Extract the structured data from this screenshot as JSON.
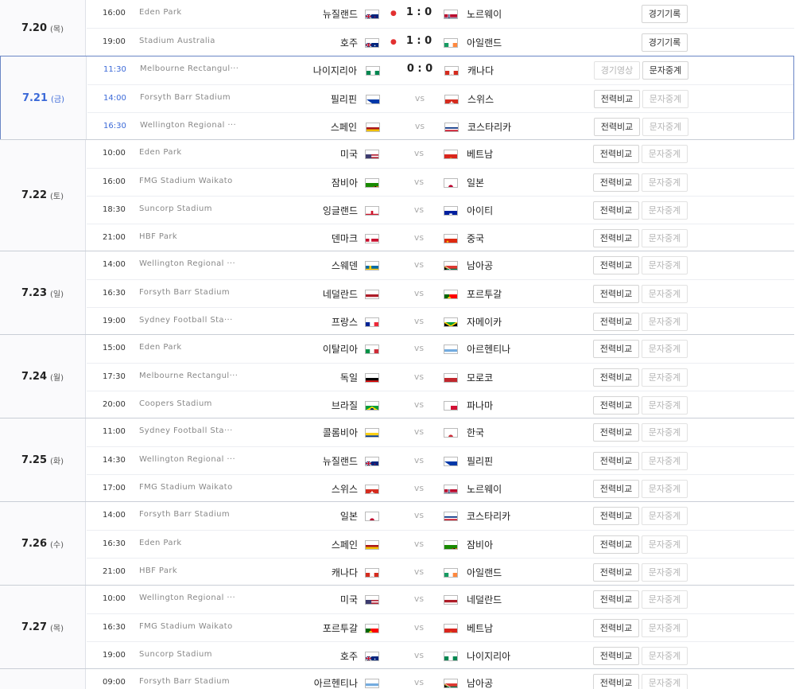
{
  "days": [
    {
      "date": "7.20",
      "dow": "(목)",
      "today": false,
      "top": 0,
      "matches": [
        {
          "time": "16:00",
          "stadium": "Eden Park",
          "home": "뉴질랜드",
          "home_flag": "nz",
          "score": "1 : 0",
          "dot": true,
          "away": "노르웨이",
          "away_flag": "no",
          "buttons": [
            {
              "label": "경기기록",
              "enabled": true
            }
          ]
        },
        {
          "time": "19:00",
          "stadium": "Stadium Australia",
          "home": "호주",
          "home_flag": "au",
          "score": "1 : 0",
          "dot": true,
          "away": "아일랜드",
          "away_flag": "ie",
          "buttons": [
            {
              "label": "경기기록",
              "enabled": true
            }
          ]
        }
      ]
    },
    {
      "date": "7.21",
      "dow": "(금)",
      "today": true,
      "matches": [
        {
          "time": "11:30",
          "stadium": "Melbourne Rectangul···",
          "home": "나이지리아",
          "home_flag": "ng",
          "score": "0 : 0",
          "dot": false,
          "away": "캐나다",
          "away_flag": "ca",
          "buttons": [
            {
              "label": "경기영상",
              "enabled": false
            },
            {
              "label": "문자중계",
              "enabled": true
            }
          ]
        },
        {
          "time": "14:00",
          "stadium": "Forsyth Barr Stadium",
          "home": "필리핀",
          "home_flag": "ph",
          "score": "vs",
          "dot": false,
          "away": "스위스",
          "away_flag": "ch",
          "buttons": [
            {
              "label": "전력비교",
              "enabled": true
            },
            {
              "label": "문자중계",
              "enabled": false
            }
          ]
        },
        {
          "time": "16:30",
          "stadium": "Wellington Regional ···",
          "home": "스페인",
          "home_flag": "es",
          "score": "vs",
          "dot": false,
          "away": "코스타리카",
          "away_flag": "cr",
          "buttons": [
            {
              "label": "전력비교",
              "enabled": true
            },
            {
              "label": "문자중계",
              "enabled": false
            }
          ]
        }
      ]
    },
    {
      "date": "7.22",
      "dow": "(토)",
      "today": false,
      "matches": [
        {
          "time": "10:00",
          "stadium": "Eden Park",
          "home": "미국",
          "home_flag": "us",
          "score": "vs",
          "dot": false,
          "away": "베트남",
          "away_flag": "vn",
          "buttons": [
            {
              "label": "전력비교",
              "enabled": true
            },
            {
              "label": "문자중계",
              "enabled": false
            }
          ]
        },
        {
          "time": "16:00",
          "stadium": "FMG Stadium Waikato",
          "home": "잠비아",
          "home_flag": "zm",
          "score": "vs",
          "dot": false,
          "away": "일본",
          "away_flag": "jp",
          "buttons": [
            {
              "label": "전력비교",
              "enabled": true
            },
            {
              "label": "문자중계",
              "enabled": false
            }
          ]
        },
        {
          "time": "18:30",
          "stadium": "Suncorp Stadium",
          "home": "잉글랜드",
          "home_flag": "en",
          "score": "vs",
          "dot": false,
          "away": "아이티",
          "away_flag": "ht",
          "buttons": [
            {
              "label": "전력비교",
              "enabled": true
            },
            {
              "label": "문자중계",
              "enabled": false
            }
          ]
        },
        {
          "time": "21:00",
          "stadium": "HBF Park",
          "home": "덴마크",
          "home_flag": "dk",
          "score": "vs",
          "dot": false,
          "away": "중국",
          "away_flag": "cn",
          "buttons": [
            {
              "label": "전력비교",
              "enabled": true
            },
            {
              "label": "문자중계",
              "enabled": false
            }
          ]
        }
      ]
    },
    {
      "date": "7.23",
      "dow": "(일)",
      "today": false,
      "matches": [
        {
          "time": "14:00",
          "stadium": "Wellington Regional ···",
          "home": "스웨덴",
          "home_flag": "se",
          "score": "vs",
          "dot": false,
          "away": "남아공",
          "away_flag": "za",
          "buttons": [
            {
              "label": "전력비교",
              "enabled": true
            },
            {
              "label": "문자중계",
              "enabled": false
            }
          ]
        },
        {
          "time": "16:30",
          "stadium": "Forsyth Barr Stadium",
          "home": "네덜란드",
          "home_flag": "nl",
          "score": "vs",
          "dot": false,
          "away": "포르투갈",
          "away_flag": "pt",
          "buttons": [
            {
              "label": "전력비교",
              "enabled": true
            },
            {
              "label": "문자중계",
              "enabled": false
            }
          ]
        },
        {
          "time": "19:00",
          "stadium": "Sydney Football Sta···",
          "home": "프랑스",
          "home_flag": "fr",
          "score": "vs",
          "dot": false,
          "away": "자메이카",
          "away_flag": "jm",
          "buttons": [
            {
              "label": "전력비교",
              "enabled": true
            },
            {
              "label": "문자중계",
              "enabled": false
            }
          ]
        }
      ]
    },
    {
      "date": "7.24",
      "dow": "(월)",
      "today": false,
      "matches": [
        {
          "time": "15:00",
          "stadium": "Eden Park",
          "home": "이탈리아",
          "home_flag": "it",
          "score": "vs",
          "dot": false,
          "away": "아르헨티나",
          "away_flag": "ar",
          "buttons": [
            {
              "label": "전력비교",
              "enabled": true
            },
            {
              "label": "문자중계",
              "enabled": false
            }
          ]
        },
        {
          "time": "17:30",
          "stadium": "Melbourne Rectangul···",
          "home": "독일",
          "home_flag": "de",
          "score": "vs",
          "dot": false,
          "away": "모로코",
          "away_flag": "ma",
          "buttons": [
            {
              "label": "전력비교",
              "enabled": true
            },
            {
              "label": "문자중계",
              "enabled": false
            }
          ]
        },
        {
          "time": "20:00",
          "stadium": "Coopers Stadium",
          "home": "브라질",
          "home_flag": "br",
          "score": "vs",
          "dot": false,
          "away": "파나마",
          "away_flag": "pa",
          "buttons": [
            {
              "label": "전력비교",
              "enabled": true
            },
            {
              "label": "문자중계",
              "enabled": false
            }
          ]
        }
      ]
    },
    {
      "date": "7.25",
      "dow": "(화)",
      "today": false,
      "matches": [
        {
          "time": "11:00",
          "stadium": "Sydney Football Sta···",
          "home": "콜롬비아",
          "home_flag": "co",
          "score": "vs",
          "dot": false,
          "away": "한국",
          "away_flag": "kr",
          "buttons": [
            {
              "label": "전력비교",
              "enabled": true
            },
            {
              "label": "문자중계",
              "enabled": false
            }
          ]
        },
        {
          "time": "14:30",
          "stadium": "Wellington Regional ···",
          "home": "뉴질랜드",
          "home_flag": "nz",
          "score": "vs",
          "dot": false,
          "away": "필리핀",
          "away_flag": "ph",
          "buttons": [
            {
              "label": "전력비교",
              "enabled": true
            },
            {
              "label": "문자중계",
              "enabled": false
            }
          ]
        },
        {
          "time": "17:00",
          "stadium": "FMG Stadium Waikato",
          "home": "스위스",
          "home_flag": "ch",
          "score": "vs",
          "dot": false,
          "away": "노르웨이",
          "away_flag": "no",
          "buttons": [
            {
              "label": "전력비교",
              "enabled": true
            },
            {
              "label": "문자중계",
              "enabled": false
            }
          ]
        }
      ]
    },
    {
      "date": "7.26",
      "dow": "(수)",
      "today": false,
      "matches": [
        {
          "time": "14:00",
          "stadium": "Forsyth Barr Stadium",
          "home": "일본",
          "home_flag": "jp",
          "score": "vs",
          "dot": false,
          "away": "코스타리카",
          "away_flag": "cr",
          "buttons": [
            {
              "label": "전력비교",
              "enabled": true
            },
            {
              "label": "문자중계",
              "enabled": false
            }
          ]
        },
        {
          "time": "16:30",
          "stadium": "Eden Park",
          "home": "스페인",
          "home_flag": "es",
          "score": "vs",
          "dot": false,
          "away": "잠비아",
          "away_flag": "zm",
          "buttons": [
            {
              "label": "전력비교",
              "enabled": true
            },
            {
              "label": "문자중계",
              "enabled": false
            }
          ]
        },
        {
          "time": "21:00",
          "stadium": "HBF Park",
          "home": "캐나다",
          "home_flag": "ca",
          "score": "vs",
          "dot": false,
          "away": "아일랜드",
          "away_flag": "ie",
          "buttons": [
            {
              "label": "전력비교",
              "enabled": true
            },
            {
              "label": "문자중계",
              "enabled": false
            }
          ]
        }
      ]
    },
    {
      "date": "7.27",
      "dow": "(목)",
      "today": false,
      "matches": [
        {
          "time": "10:00",
          "stadium": "Wellington Regional ···",
          "home": "미국",
          "home_flag": "us",
          "score": "vs",
          "dot": false,
          "away": "네덜란드",
          "away_flag": "nl",
          "buttons": [
            {
              "label": "전력비교",
              "enabled": true
            },
            {
              "label": "문자중계",
              "enabled": false
            }
          ]
        },
        {
          "time": "16:30",
          "stadium": "FMG Stadium Waikato",
          "home": "포르투갈",
          "home_flag": "pt",
          "score": "vs",
          "dot": false,
          "away": "베트남",
          "away_flag": "vn",
          "buttons": [
            {
              "label": "전력비교",
              "enabled": true
            },
            {
              "label": "문자중계",
              "enabled": false
            }
          ]
        },
        {
          "time": "19:00",
          "stadium": "Suncorp Stadium",
          "home": "호주",
          "home_flag": "au",
          "score": "vs",
          "dot": false,
          "away": "나이지리아",
          "away_flag": "ng",
          "buttons": [
            {
              "label": "전력비교",
              "enabled": true
            },
            {
              "label": "문자중계",
              "enabled": false
            }
          ]
        }
      ]
    },
    {
      "date": "",
      "dow": "",
      "today": false,
      "matches": [
        {
          "time": "09:00",
          "stadium": "Forsyth Barr Stadium",
          "home": "아르헨티나",
          "home_flag": "ar",
          "score": "vs",
          "dot": false,
          "away": "남아공",
          "away_flag": "za",
          "buttons": [
            {
              "label": "전력비교",
              "enabled": true
            },
            {
              "label": "문자중계",
              "enabled": false
            }
          ]
        }
      ]
    }
  ],
  "flag_colors": {
    "nz": [
      "#00247d",
      "#c8102e"
    ],
    "no": [
      "#ba0c2f",
      "#fff",
      "#00205b"
    ],
    "au": [
      "#00247d",
      "#fff"
    ],
    "ie": [
      "#169b62",
      "#fff",
      "#ff883e"
    ],
    "ng": [
      "#008751",
      "#fff",
      "#008751"
    ],
    "ca": [
      "#d52b1e",
      "#fff",
      "#d52b1e"
    ],
    "ph": [
      "#0038a8",
      "#ce1126",
      "#fff"
    ],
    "ch": [
      "#d52b1e",
      "#fff"
    ],
    "es": [
      "#aa151b",
      "#f1bf00",
      "#aa151b"
    ],
    "cr": [
      "#002b7f",
      "#fff",
      "#ce1126"
    ],
    "us": [
      "#b22234",
      "#fff",
      "#3c3b6e"
    ],
    "vn": [
      "#da251d",
      "#ffcd00"
    ],
    "zm": [
      "#198a00",
      "#ef7d00"
    ],
    "jp": [
      "#fff",
      "#bc002d"
    ],
    "en": [
      "#fff",
      "#cf142b"
    ],
    "ht": [
      "#00209f",
      "#d21034"
    ],
    "dk": [
      "#c8102e",
      "#fff"
    ],
    "cn": [
      "#de2910",
      "#ffde00"
    ],
    "se": [
      "#006aa7",
      "#fecc00"
    ],
    "za": [
      "#007a4d",
      "#ffb612",
      "#de3831"
    ],
    "nl": [
      "#ae1c28",
      "#fff",
      "#21468b"
    ],
    "pt": [
      "#006600",
      "#ff0000"
    ],
    "fr": [
      "#002395",
      "#fff",
      "#ed2939"
    ],
    "jm": [
      "#009b3a",
      "#fed100",
      "#000"
    ],
    "it": [
      "#009246",
      "#fff",
      "#ce2b37"
    ],
    "ar": [
      "#74acdf",
      "#fff",
      "#74acdf"
    ],
    "de": [
      "#000",
      "#dd0000",
      "#ffce00"
    ],
    "ma": [
      "#c1272d",
      "#006233"
    ],
    "br": [
      "#009c3b",
      "#ffdf00",
      "#002776"
    ],
    "pa": [
      "#fff",
      "#d21034",
      "#005293"
    ],
    "co": [
      "#fcd116",
      "#003893",
      "#ce1126"
    ],
    "kr": [
      "#fff",
      "#cd2e3a",
      "#0047a0"
    ]
  }
}
